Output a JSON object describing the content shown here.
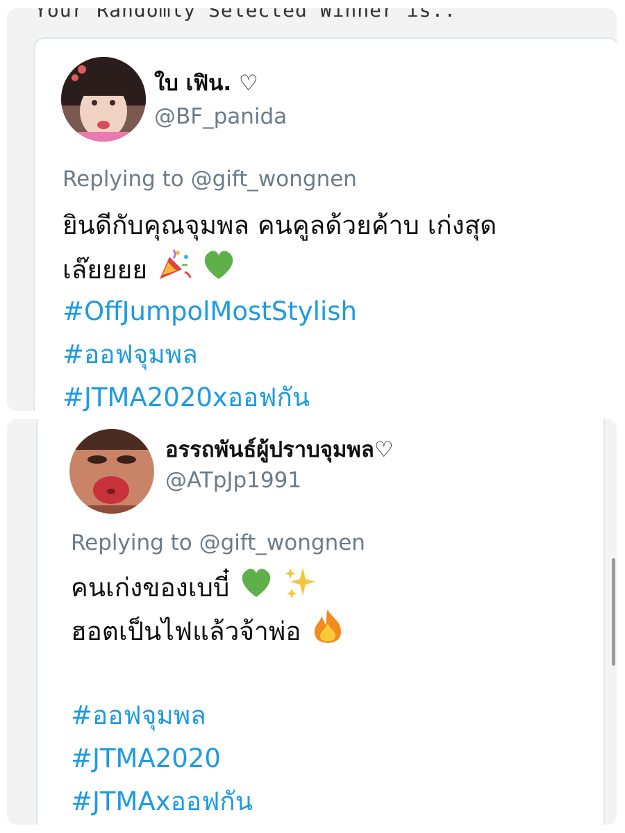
{
  "header": {
    "text": "Your Randomly Selected Winner is.."
  },
  "tweets": [
    {
      "display_name": "ใบ เฟิน. ♡",
      "handle": "@BF_panida",
      "reply_to": "Replying to @gift_wongnen",
      "lines": [
        "ยินดีกับคุณจุมพล คนคูลด้วยค้าบ เก่งสุด",
        "เล๊ยยยย"
      ],
      "emojis_line2": [
        "party-popper-icon",
        "green-heart-icon"
      ],
      "hashtags": [
        "#OffJumpolMostStylish",
        "#ออฟจุมพล",
        "#JTMA2020xออฟกัน"
      ]
    },
    {
      "display_name": "อรรถพันธ์ผู้ปราบจุมพล♡",
      "handle": "@ATpJp1991",
      "reply_to": "Replying to @gift_wongnen",
      "lines": [
        "คนเก่งของเบบี๋",
        "ฮอตเป็นไฟแล้วจ้าพ่อ"
      ],
      "emojis_line1": [
        "green-heart-icon",
        "sparkles-icon"
      ],
      "emojis_line2": [
        "fire-icon"
      ],
      "hashtags": [
        "#ออฟจุมพล",
        "#JTMA2020",
        "#JTMAxออฟกัน"
      ]
    }
  ],
  "colors": {
    "hashtag": "#1d9be2",
    "secondary_text": "#6b7b88",
    "panel_bg": "#f3f3f3",
    "card_border": "#dfe6ec"
  }
}
